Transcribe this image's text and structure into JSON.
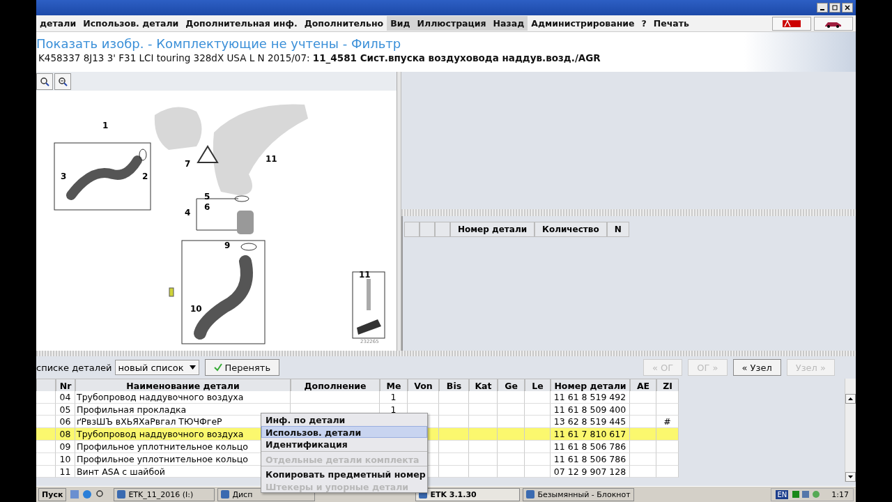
{
  "menu": [
    "детали",
    "Использов. детали",
    "Дополнительная инф.",
    "Дополнительно",
    "Вид",
    "Иллюстрация",
    "Назад",
    "Администрирование",
    "?",
    "Печать"
  ],
  "header": {
    "title": "Показать изобр. - Комплектующие не учтены - Фильтр",
    "subtitle": "K458337 8J13 3' F31 LCI touring 328dX USA L N 2015/07: **11_4581 Сист.впуска воздуховода наддув.возд./AGR**"
  },
  "diagram": {
    "callouts": [
      "1",
      "2",
      "3",
      "7",
      "11",
      "5",
      "6",
      "4",
      "9",
      "10",
      "11"
    ],
    "drawing_number": "232265"
  },
  "parts_list": {
    "columns": [
      "Номер детали",
      "Количество",
      "N"
    ]
  },
  "list_bar": {
    "label": "списке деталей",
    "list_select": "новый список",
    "apply_button": "Перенять",
    "nav_buttons": [
      {
        "label": "« ОГ",
        "disabled": true
      },
      {
        "label": "ОГ »",
        "disabled": true
      },
      {
        "label": "« Узел",
        "disabled": false
      },
      {
        "label": "Узел »",
        "disabled": true
      }
    ]
  },
  "table": {
    "columns": [
      "Nr",
      "Наименование детали",
      "Дополнение",
      "Me",
      "Von",
      "Bis",
      "Kat",
      "Ge",
      "Le",
      "Номер детали",
      "AE",
      "ZI"
    ],
    "rows": [
      {
        "nr": "04",
        "name": "Трубопровод наддувочного воздуха",
        "me": "1",
        "part_number": "11 61 8 519 492",
        "selected": false
      },
      {
        "nr": "05",
        "name": "Профильная прокладка",
        "me": "1",
        "part_number": "11 61 8 509 400",
        "selected": false
      },
      {
        "nr": "06",
        "name": "ґРвзШЪ вХЬЯХаРвгал ТЮЧФгеР",
        "part_number": "13 62 8 519 445",
        "zi": "#",
        "selected": false
      },
      {
        "nr": "08",
        "name": "Трубопровод наддувочного воздуха",
        "part_number": "11 61 7 810 617",
        "selected": true
      },
      {
        "nr": "09",
        "name": "Профильное уплотнительное кольцо",
        "part_number": "11 61 8 506 786",
        "selected": false
      },
      {
        "nr": "10",
        "name": "Профильное уплотнительное кольцо",
        "part_number": "11 61 8 506 786",
        "selected": false
      },
      {
        "nr": "11",
        "name": "Винт ASA с шайбой",
        "part_number": "07 12 9 907 128",
        "selected": false
      }
    ]
  },
  "context_menu": {
    "items": [
      {
        "kind": "item",
        "label": "Инф. по детали",
        "selected": false,
        "disabled": false
      },
      {
        "kind": "item",
        "label": "Использов. детали",
        "selected": true,
        "disabled": false
      },
      {
        "kind": "item",
        "label": "Идентификация",
        "selected": false,
        "disabled": false
      },
      {
        "kind": "separator"
      },
      {
        "kind": "item",
        "label": "Отдельные детали комплекта",
        "selected": false,
        "disabled": true
      },
      {
        "kind": "separator"
      },
      {
        "kind": "item",
        "label": "Копировать предметный номер",
        "selected": false,
        "disabled": false
      },
      {
        "kind": "item",
        "label": "Штекеры и упорные детали",
        "selected": false,
        "disabled": true
      }
    ]
  },
  "taskbar": {
    "start": "Пуск",
    "tasks": [
      {
        "label": "ETK_11_2016 (I:)",
        "selected": false
      },
      {
        "label": "Дисп",
        "selected": false
      },
      {
        "label": "ETK 3.1.30",
        "selected": true
      },
      {
        "label": "Безымянный - Блокнот",
        "selected": false
      }
    ],
    "language": "EN",
    "time": "1:17"
  }
}
